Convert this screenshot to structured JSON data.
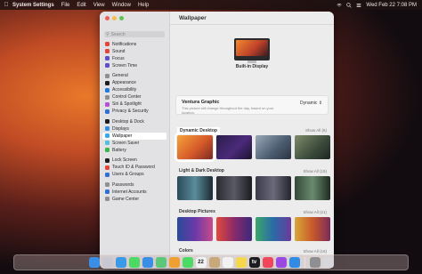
{
  "menubar": {
    "apple": "",
    "items": [
      "System Settings",
      "File",
      "Edit",
      "View",
      "Window",
      "Help"
    ],
    "clock": "Wed Feb 22  7:08 PM"
  },
  "window": {
    "title": "Wallpaper",
    "search_placeholder": "Search",
    "sidebar": [
      {
        "label": "Notifications",
        "color": "#e4453a"
      },
      {
        "label": "Sound",
        "color": "#e4453a"
      },
      {
        "label": "Focus",
        "color": "#5d4fc8"
      },
      {
        "label": "Screen Time",
        "color": "#5d4fc8"
      },
      {
        "label": "General",
        "color": "#8e8e93"
      },
      {
        "label": "Appearance",
        "color": "#1c1c1e"
      },
      {
        "label": "Accessibility",
        "color": "#1f7ae0"
      },
      {
        "label": "Control Center",
        "color": "#8e8e93"
      },
      {
        "label": "Siri & Spotlight",
        "color": "#b44fd6"
      },
      {
        "label": "Privacy & Security",
        "color": "#2f6fd6"
      },
      {
        "label": "Desktop & Dock",
        "color": "#1c1c1e"
      },
      {
        "label": "Displays",
        "color": "#2f8be3"
      },
      {
        "label": "Wallpaper",
        "color": "#38a8e8",
        "active": true
      },
      {
        "label": "Screen Saver",
        "color": "#53bfd9"
      },
      {
        "label": "Battery",
        "color": "#3cb54a"
      },
      {
        "label": "Lock Screen",
        "color": "#1c1c1e"
      },
      {
        "label": "Touch ID & Password",
        "color": "#e4453a"
      },
      {
        "label": "Users & Groups",
        "color": "#2f6fd6"
      },
      {
        "label": "Passwords",
        "color": "#8e8e93"
      },
      {
        "label": "Internet Accounts",
        "color": "#2f6fd6"
      },
      {
        "label": "Game Center",
        "color": "#8e8e93"
      }
    ],
    "display_name": "Built-in Display",
    "current": {
      "name": "Ventura Graphic",
      "description": "This picture will change throughout the day, based on your location.",
      "mode": "Dynamic"
    },
    "sections": [
      {
        "label": "Dynamic Desktop",
        "show_all": "Show All (6)",
        "thumbs": [
          "linear-gradient(135deg,#f6a33a,#d65a2a 55%,#7a2a22)",
          "linear-gradient(135deg,#2a1e4a,#4b2a7a 55%,#1a1430)",
          "linear-gradient(135deg,#9aa7b8,#4a5a6e 60%,#2a3440)",
          "linear-gradient(135deg,#7f8c6a,#3a4a3a 60%,#1e2420)"
        ]
      },
      {
        "label": "Light & Dark Desktop",
        "show_all": "Show All (15)",
        "thumbs": [
          "linear-gradient(90deg,#2b4a5a,#5b8c9a 50%,#1a2a34)",
          "linear-gradient(90deg,#2a2a30,#5a5a66 50%,#1a1a20)",
          "linear-gradient(90deg,#3a3a4a,#6a6a7a 50%,#24242c)",
          "linear-gradient(90deg,#344a3a,#6a8a6e 50%,#1e2c22)"
        ]
      },
      {
        "label": "Desktop Pictures",
        "show_all": "Show All (21)",
        "thumbs": [
          "linear-gradient(90deg,#2a4a9a,#6a3aa8 50%,#c84a8a)",
          "linear-gradient(90deg,#e24a3a,#8a2a6a 50%,#3a2a7a)",
          "linear-gradient(90deg,#3aa86a,#2a6aa8 50%,#6a3a9a)",
          "linear-gradient(90deg,#d8a83a,#c85a2a 50%,#7a2a5a)"
        ]
      },
      {
        "label": "Colors",
        "show_all": "Show All (16)",
        "thumbs": []
      }
    ]
  },
  "dock": {
    "icons": [
      "finder-icon",
      "launchpad-icon",
      "safari-icon",
      "messages-icon",
      "mail-icon",
      "maps-icon",
      "photos-icon",
      "facetime-icon",
      "calendar-icon",
      "contacts-icon",
      "reminders-icon",
      "notes-icon",
      "tv-icon",
      "music-icon",
      "podcasts-icon",
      "appstore-icon",
      "settings-icon",
      "trash-icon"
    ],
    "colors": [
      "#3a8ee6",
      "#c8c8d2",
      "#3a9ae8",
      "#4cd964",
      "#3a8ee6",
      "#5ac878",
      "#f0a030",
      "#4cd964",
      "#f2f2f2",
      "#c8a878",
      "#f2f2f2",
      "#f6d64a",
      "#1c1c1e",
      "#f0455a",
      "#9a4ae0",
      "#2f8be3",
      "#8e8e93",
      "#d8d8dc"
    ],
    "calendar_day": "22",
    "tv_label": "tv"
  }
}
